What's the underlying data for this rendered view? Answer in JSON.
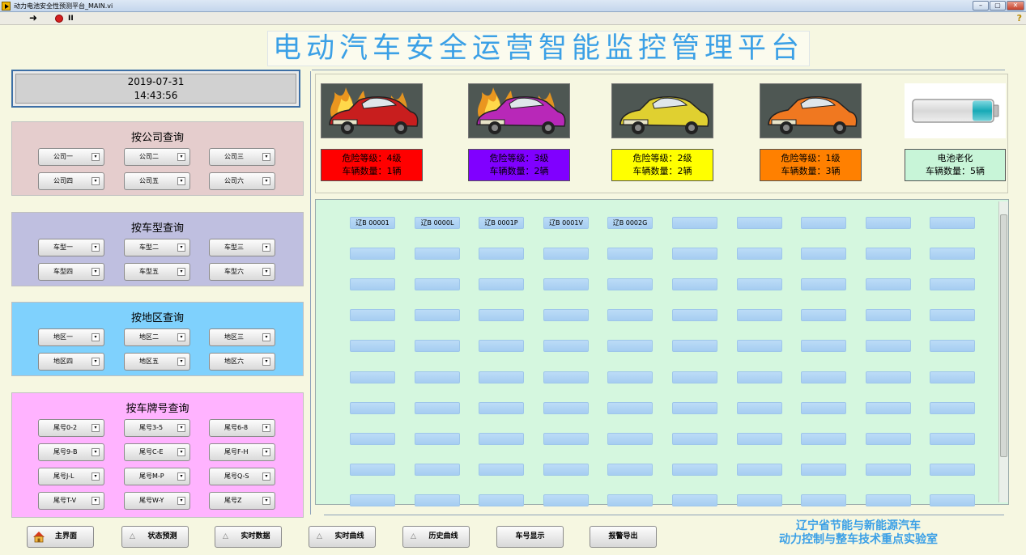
{
  "window": {
    "title": "动力电池安全性预测平台_MAIN.vi",
    "controls": {
      "minimize": "–",
      "maximize": "▢",
      "close": "✕"
    }
  },
  "toolbar": {
    "run_icon": "➜",
    "pause_icon": "II",
    "help_icon": "?"
  },
  "main_title": "电动汽车安全运营智能监控管理平台",
  "datetime": {
    "date": "2019-07-31",
    "time": "14:43:56"
  },
  "panels": [
    {
      "title": "按公司查询",
      "bg": "#e5cdcd",
      "items": [
        "公司一",
        "公司二",
        "公司三",
        "公司四",
        "公司五",
        "公司六"
      ]
    },
    {
      "title": "按车型查询",
      "bg": "#bfbfe0",
      "items": [
        "车型一",
        "车型二",
        "车型三",
        "车型四",
        "车型五",
        "车型六"
      ]
    },
    {
      "title": "按地区查询",
      "bg": "#7fd1fd",
      "items": [
        "地区一",
        "地区二",
        "地区三",
        "地区四",
        "地区五",
        "地区六"
      ]
    },
    {
      "title": "按车牌号查询",
      "bg": "#ffb3ff",
      "items": [
        "尾号0-2",
        "尾号3-5",
        "尾号6-8",
        "尾号9-B",
        "尾号C-E",
        "尾号F-H",
        "尾号J-L",
        "尾号M-P",
        "尾号Q-S",
        "尾号T-V",
        "尾号W-Y",
        "尾号Z"
      ]
    }
  ],
  "risk_levels": [
    {
      "line1": "危险等级：4级",
      "line2": "车辆数量：1辆",
      "bg": "#ff0000",
      "car_color": "#c81e1e",
      "fire": true
    },
    {
      "line1": "危险等级：3级",
      "line2": "车辆数量：2辆",
      "bg": "#8000ff",
      "car_color": "#b828b8",
      "fire": true
    },
    {
      "line1": "危险等级：2级",
      "line2": "车辆数量：2辆",
      "bg": "#ffff00",
      "car_color": "#e0d030",
      "fire": false
    },
    {
      "line1": "危险等级：1级",
      "line2": "车辆数量：3辆",
      "bg": "#ff8000",
      "car_color": "#f07820",
      "fire": false
    }
  ],
  "battery": {
    "line1": "电池老化",
    "line2": "车辆数量：5辆",
    "bg": "#c8f5d8"
  },
  "plates": [
    "辽B 00001",
    "辽B 0000L",
    "辽B 0001P",
    "辽B 0001V",
    "辽B 0002G"
  ],
  "plate_grid": {
    "rows": 10,
    "cols": 10
  },
  "nav_buttons": [
    "主界面",
    "状态预测",
    "实时数据",
    "实时曲线",
    "历史曲线",
    "车号显示",
    "报警导出"
  ],
  "footer": {
    "line1": "辽宁省节能与新能源汽车",
    "line2": "动力控制与整车技术重点实验室"
  }
}
